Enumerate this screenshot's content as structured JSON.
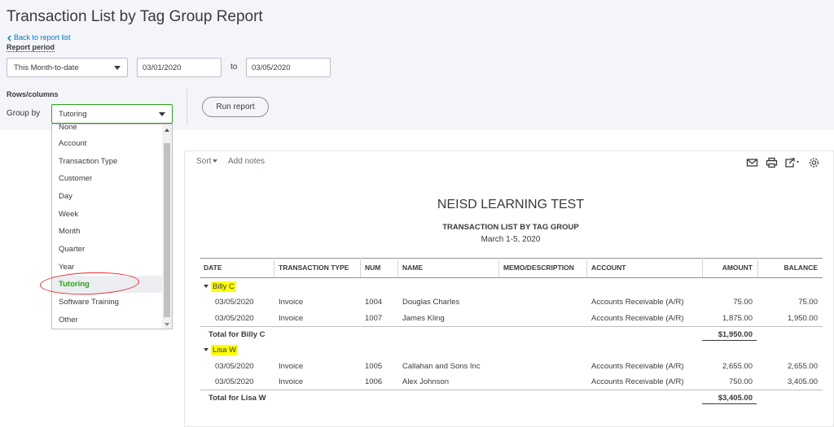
{
  "page": {
    "title": "Transaction List by Tag Group Report",
    "back_link": "Back to report list",
    "report_period_label": "Report period",
    "period_select": "This Month-to-date",
    "date_from": "03/01/2020",
    "to_label": "to",
    "date_to": "03/05/2020",
    "rows_columns_label": "Rows/columns",
    "group_by_label": "Group by",
    "group_by_value": "Tutoring",
    "run_report": "Run report"
  },
  "dropdown": {
    "items": [
      "None",
      "Account",
      "Transaction Type",
      "Customer",
      "Day",
      "Week",
      "Month",
      "Quarter",
      "Year",
      "Tutoring",
      "Software Training",
      "Other"
    ],
    "selected": "Tutoring"
  },
  "toolbar": {
    "sort": "Sort",
    "add_notes": "Add notes",
    "icons": [
      "email-icon",
      "print-icon",
      "export-icon",
      "settings-icon"
    ]
  },
  "report": {
    "company": "NEISD LEARNING TEST",
    "name": "TRANSACTION LIST BY TAG GROUP",
    "dates": "March 1-5, 2020",
    "columns": [
      "DATE",
      "TRANSACTION TYPE",
      "NUM",
      "NAME",
      "MEMO/DESCRIPTION",
      "ACCOUNT",
      "AMOUNT",
      "BALANCE"
    ],
    "groups": [
      {
        "name": "Billy C",
        "rows": [
          {
            "date": "03/05/2020",
            "type": "Invoice",
            "num": "1004",
            "name": "Douglas Charles",
            "memo": "",
            "account": "Accounts Receivable (A/R)",
            "amount": "75.00",
            "balance": "75.00"
          },
          {
            "date": "03/05/2020",
            "type": "Invoice",
            "num": "1007",
            "name": "James Kling",
            "memo": "",
            "account": "Accounts Receivable (A/R)",
            "amount": "1,875.00",
            "balance": "1,950.00"
          }
        ],
        "total_label": "Total for Billy C",
        "total": "$1,950.00"
      },
      {
        "name": "Lisa W",
        "rows": [
          {
            "date": "03/05/2020",
            "type": "Invoice",
            "num": "1005",
            "name": "Callahan and Sons Inc",
            "memo": "",
            "account": "Accounts Receivable (A/R)",
            "amount": "2,655.00",
            "balance": "2,655.00"
          },
          {
            "date": "03/05/2020",
            "type": "Invoice",
            "num": "1006",
            "name": "Alex Johnson",
            "memo": "",
            "account": "Accounts Receivable (A/R)",
            "amount": "750.00",
            "balance": "3,405.00"
          }
        ],
        "total_label": "Total for Lisa W",
        "total": "$3,405.00"
      }
    ]
  },
  "colors": {
    "accent_green": "#2ca01c",
    "link_blue": "#0077c5",
    "highlight_yellow": "#ffff00",
    "annotation_red": "#e8262a"
  }
}
